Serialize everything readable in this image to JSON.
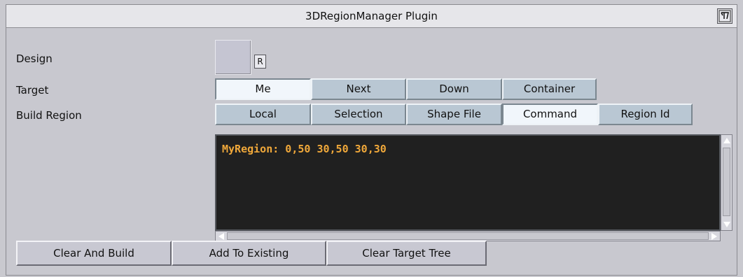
{
  "title": "3DRegionManager Plugin",
  "labels": {
    "design": "Design",
    "target": "Target",
    "build_region": "Build Region"
  },
  "design": {
    "reset_label": "R"
  },
  "target": {
    "options": [
      "Me",
      "Next",
      "Down",
      "Container"
    ],
    "selected": "Me"
  },
  "build_region": {
    "options": [
      "Local",
      "Selection",
      "Shape File",
      "Command",
      "Region Id"
    ],
    "selected": "Command"
  },
  "command_text": "MyRegion: 0,50 30,50 30,30",
  "buttons": {
    "clear_and_build": "Clear And Build",
    "add_to_existing": "Add To Existing",
    "clear_target_tree": "Clear Target Tree"
  },
  "colors": {
    "command_bg": "#202020",
    "command_text": "#f0a83a",
    "segment_bg": "#b9c7d3",
    "segment_active": "#f1f6fb"
  },
  "icons": {
    "corner": "plugin-help-icon"
  }
}
